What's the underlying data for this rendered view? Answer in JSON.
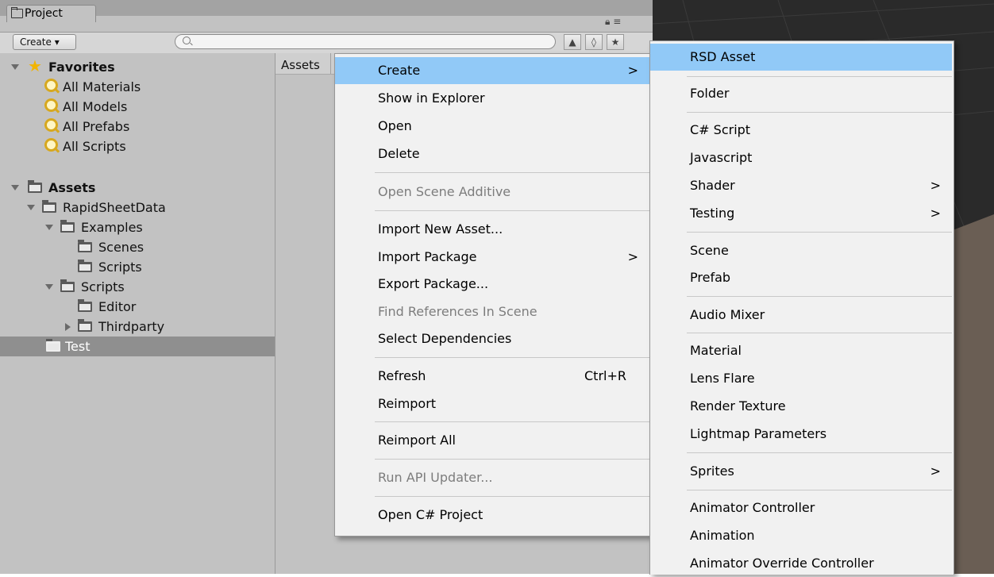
{
  "project_tab": {
    "title": "Project"
  },
  "toolbar": {
    "create_label": "Create ▾",
    "search_value": ""
  },
  "favorites": {
    "label": "Favorites",
    "items": [
      "All Materials",
      "All Models",
      "All Prefabs",
      "All Scripts"
    ]
  },
  "assets_tree": {
    "label": "Assets",
    "rapidsheetdata": "RapidSheetData",
    "examples": "Examples",
    "scenes": "Scenes",
    "scripts_ex": "Scripts",
    "scripts": "Scripts",
    "editor": "Editor",
    "thirdparty": "Thirdparty",
    "test": "Test"
  },
  "path": {
    "label": "Assets"
  },
  "context_menu": {
    "create": "Create",
    "show_in_explorer": "Show in Explorer",
    "open": "Open",
    "delete": "Delete",
    "open_scene_additive": "Open Scene Additive",
    "import_new_asset": "Import New Asset...",
    "import_package": "Import Package",
    "export_package": "Export Package...",
    "find_references": "Find References In Scene",
    "select_dependencies": "Select Dependencies",
    "refresh": "Refresh",
    "refresh_shortcut": "Ctrl+R",
    "reimport": "Reimport",
    "reimport_all": "Reimport All",
    "run_api_updater": "Run API Updater...",
    "open_csharp_project": "Open C# Project",
    "submenu_arrow": ">"
  },
  "create_submenu": {
    "rsd_asset": "RSD Asset",
    "folder": "Folder",
    "csharp_script": "C# Script",
    "javascript": "Javascript",
    "shader": "Shader",
    "testing": "Testing",
    "scene": "Scene",
    "prefab": "Prefab",
    "audio_mixer": "Audio Mixer",
    "material": "Material",
    "lens_flare": "Lens Flare",
    "render_texture": "Render Texture",
    "lightmap_parameters": "Lightmap Parameters",
    "sprites": "Sprites",
    "animator_controller": "Animator Controller",
    "animation": "Animation",
    "animator_override_controller": "Animator Override Controller",
    "submenu_arrow": ">"
  },
  "colors": {
    "highlight": "#91c9f7",
    "panel": "#c2c2c2",
    "selected_row": "#8f8f8f",
    "favorites_star": "#f2b400"
  }
}
